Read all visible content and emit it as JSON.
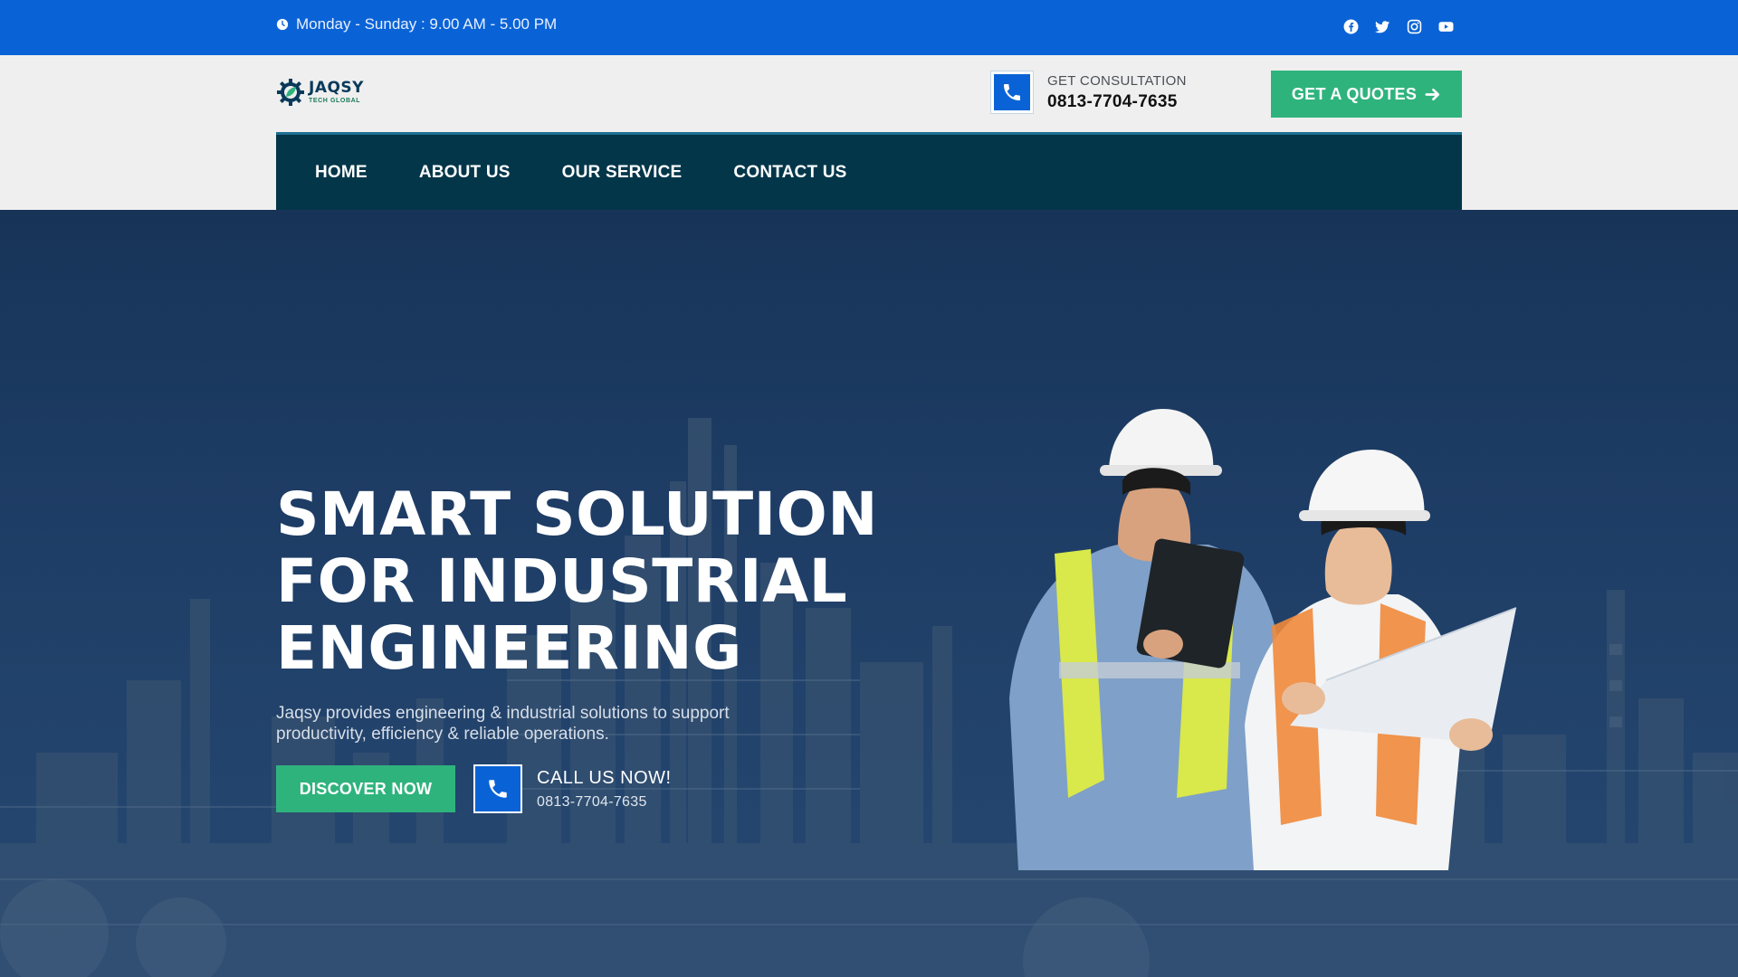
{
  "topbar": {
    "hours": "Monday - Sunday : 9.00 AM - 5.00 PM",
    "icons": [
      "clock-icon",
      "facebook-icon",
      "twitter-icon",
      "instagram-icon",
      "youtube-icon"
    ]
  },
  "header": {
    "logo_name": "JAQSY",
    "logo_sub": "TECH GLOBAL",
    "consult_label": "GET CONSULTATION",
    "consult_phone": "0813-7704-7635",
    "quote_button": "GET A QUOTES"
  },
  "nav": {
    "items": [
      {
        "label": "HOME"
      },
      {
        "label": "ABOUT US"
      },
      {
        "label": "OUR SERVICE"
      },
      {
        "label": "CONTACT US"
      }
    ]
  },
  "hero": {
    "title_lines": [
      "SMART SOLUTION",
      "FOR INDUSTRIAL",
      "ENGINEERING"
    ],
    "description": "Jaqsy provides engineering & industrial solutions to support productivity, efficiency & reliable operations.",
    "discover_button": "DISCOVER NOW",
    "call_label": "CALL US NOW!",
    "call_phone": "0813-7704-7635"
  },
  "colors": {
    "topbar": "#0a63d6",
    "accent_green": "#2fb37d",
    "nav_bg": "#033649",
    "header_bg": "#efefef"
  }
}
